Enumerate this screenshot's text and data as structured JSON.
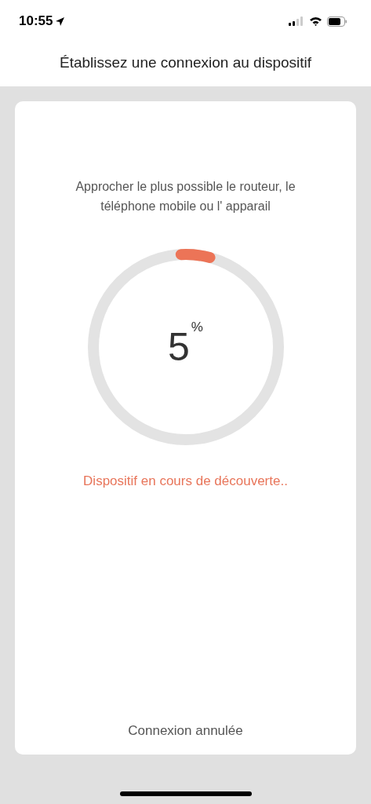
{
  "status_bar": {
    "time": "10:55"
  },
  "title": "Établissez une connexion au dispositif",
  "instruction": "Approcher le plus possible le routeur, le téléphone mobile ou l' apparail",
  "progress": {
    "value": "5",
    "unit": "%"
  },
  "status_message": "Dispositif en cours de découverte..",
  "cancel_button": "Connexion annulée"
}
